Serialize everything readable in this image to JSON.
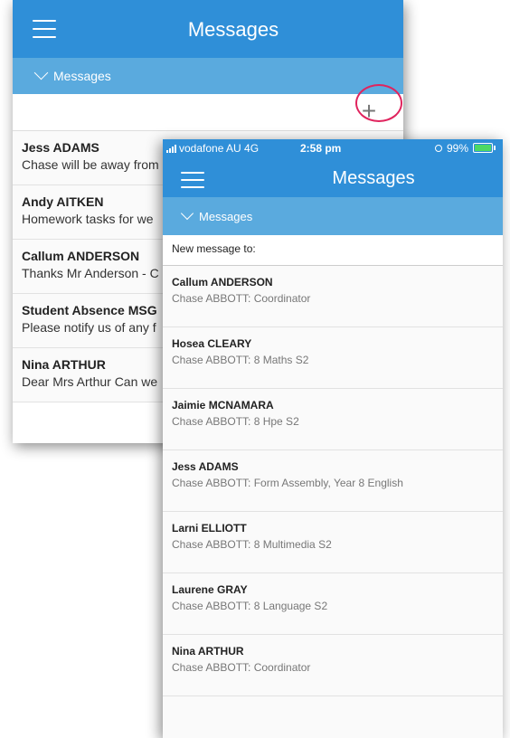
{
  "back_screen": {
    "header": {
      "title": "Messages"
    },
    "subheader": {
      "label": "Messages"
    },
    "toolbar": {
      "new_message_symbol": "+"
    },
    "messages": [
      {
        "name": "Jess ADAMS",
        "preview": "Chase will be away from"
      },
      {
        "name": "Andy AITKEN",
        "preview": "Homework tasks for we"
      },
      {
        "name": "Callum ANDERSON",
        "preview": "Thanks Mr Anderson - C"
      },
      {
        "name": "Student Absence MSG",
        "preview": "Please notify us of any f"
      },
      {
        "name": "Nina ARTHUR",
        "preview": "Dear Mrs Arthur Can we"
      }
    ]
  },
  "front_screen": {
    "status_bar": {
      "carrier": "vodafone AU  4G",
      "time": "2:58 pm",
      "battery": "99%"
    },
    "header": {
      "title": "Messages"
    },
    "subheader": {
      "label": "Messages"
    },
    "new_message_label": "New message to:",
    "recipients": [
      {
        "name": "Callum ANDERSON",
        "detail": "Chase ABBOTT: Coordinator"
      },
      {
        "name": "Hosea CLEARY",
        "detail": "Chase ABBOTT: 8 Maths S2"
      },
      {
        "name": "Jaimie MCNAMARA",
        "detail": "Chase ABBOTT: 8 Hpe S2"
      },
      {
        "name": "Jess ADAMS",
        "detail": "Chase ABBOTT: Form Assembly, Year 8 English"
      },
      {
        "name": "Larni ELLIOTT",
        "detail": "Chase ABBOTT: 8 Multimedia S2"
      },
      {
        "name": "Laurene GRAY",
        "detail": "Chase ABBOTT: 8 Language S2"
      },
      {
        "name": "Nina ARTHUR",
        "detail": "Chase ABBOTT: Coordinator"
      }
    ]
  },
  "colors": {
    "header": "#2f8fd8",
    "subheader": "#5aaade",
    "highlight_ring": "#e0245e",
    "battery": "#4cd964"
  }
}
